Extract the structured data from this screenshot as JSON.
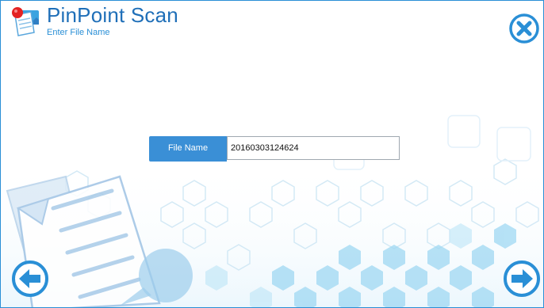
{
  "app": {
    "title": "PinPoint Scan",
    "subtitle": "Enter File Name"
  },
  "form": {
    "file_name_label": "File Name",
    "file_name_value": "20160303124624"
  },
  "icons": {
    "logo": "pinpoint-scan-logo-icon",
    "close": "close-x-circle-icon",
    "back": "arrow-left-circle-icon",
    "next": "arrow-right-circle-icon"
  },
  "colors": {
    "accent": "#2a8fd6",
    "title_text": "#1f6fb8",
    "label_bg": "#3a8fd6"
  }
}
